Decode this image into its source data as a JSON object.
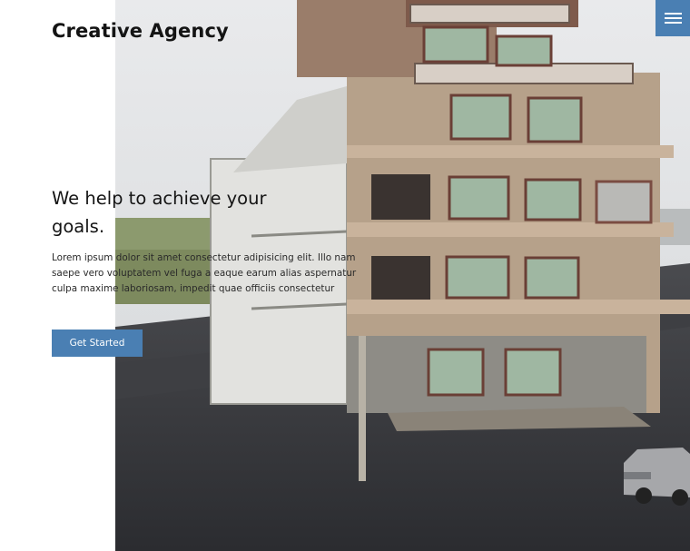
{
  "header": {
    "brand_title": "Creative Agency",
    "menu_icon": "hamburger-menu-icon",
    "accent_color": "#4a7fb3"
  },
  "hero": {
    "headline": "We help to achieve your goals.",
    "body_text": "Lorem ipsum dolor sit amet consectetur adipisicing elit. Illo nam saepe vero voluptatem vel fuga a eaque earum alias aspernatur culpa maxime laboriosam, impedit quae officiis consectetur",
    "cta_label": "Get Started"
  }
}
